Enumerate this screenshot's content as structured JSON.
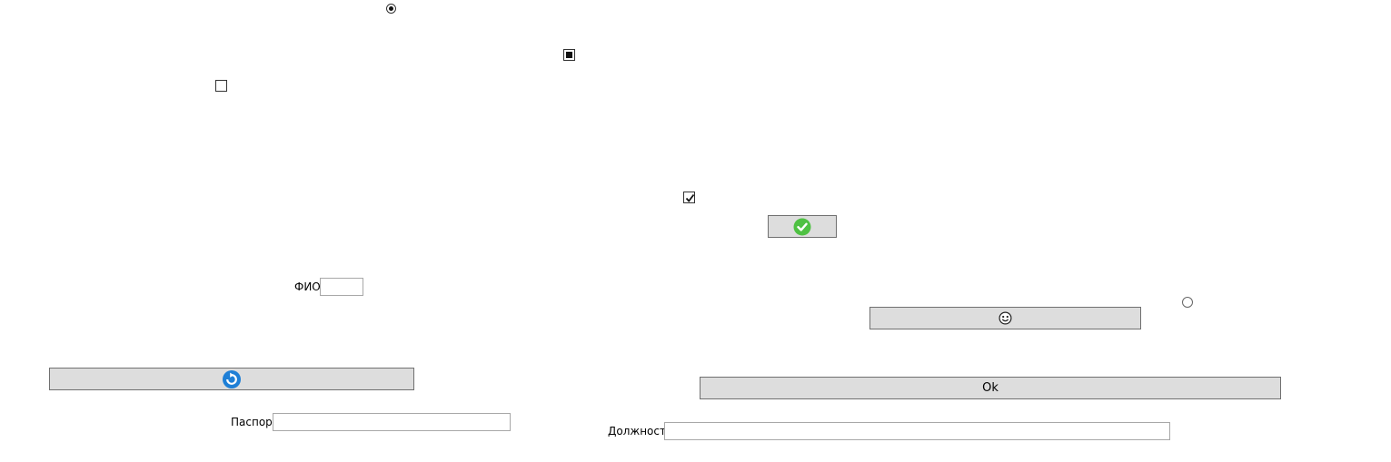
{
  "controls": {
    "radio_top": {
      "checked": true
    },
    "checkbox_indeterminate": {
      "state": "indeterminate"
    },
    "checkbox_empty": {
      "checked": false
    },
    "checkbox_checked": {
      "checked": true
    },
    "radio_right": {
      "checked": false
    }
  },
  "buttons": {
    "check_button": {
      "icon": "green-check-icon",
      "color": "#4fc143"
    },
    "emoji_button": {
      "icon": "smiley-face-icon"
    },
    "refresh_button": {
      "icon": "blue-refresh-icon",
      "color": "#1e7fd6"
    },
    "ok_button": {
      "label": "Ok"
    }
  },
  "fields": {
    "fio": {
      "label": "ФИО",
      "value": ""
    },
    "passport": {
      "label": "Паспорт",
      "value": ""
    },
    "position": {
      "label": "Должность",
      "value": ""
    }
  }
}
